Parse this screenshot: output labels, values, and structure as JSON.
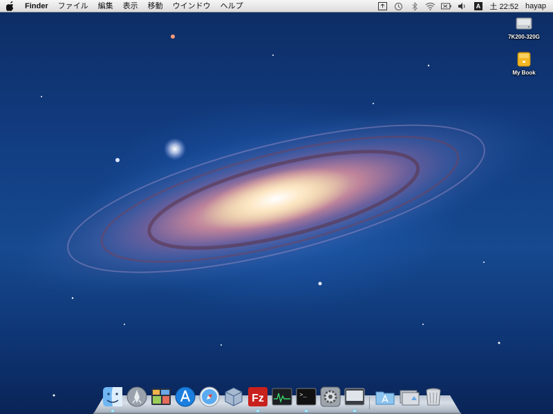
{
  "menubar": {
    "apple_icon": "apple-logo-icon",
    "app_name": "Finder",
    "items": [
      {
        "label": "ファイル"
      },
      {
        "label": "編集"
      },
      {
        "label": "表示"
      },
      {
        "label": "移動"
      },
      {
        "label": "ウインドウ"
      },
      {
        "label": "ヘルプ"
      }
    ],
    "status_icons": [
      "screen-sharing-icon",
      "time-machine-icon",
      "bluetooth-icon",
      "wifi-icon",
      "battery-icon",
      "volume-icon",
      "input-method-icon"
    ],
    "input_method_glyph": "A",
    "clock": "土 22:52",
    "user": "hayap"
  },
  "desktop_icons": [
    {
      "label": "7K200-320G",
      "icon": "hard-drive-icon"
    },
    {
      "label": "My Book",
      "icon": "external-drive-icon"
    }
  ],
  "dock": {
    "items": [
      {
        "name": "finder",
        "icon": "finder-icon"
      },
      {
        "name": "launchpad",
        "icon": "launchpad-icon"
      },
      {
        "name": "mission-control",
        "icon": "mission-control-icon"
      },
      {
        "name": "app-store",
        "icon": "app-store-icon"
      },
      {
        "name": "safari",
        "icon": "safari-icon"
      },
      {
        "name": "virtualbox",
        "icon": "virtualbox-icon"
      },
      {
        "name": "filezilla",
        "icon": "filezilla-icon",
        "glyph": "Fz"
      },
      {
        "name": "activity-monitor",
        "icon": "activity-monitor-icon"
      },
      {
        "name": "terminal",
        "icon": "terminal-icon",
        "glyph": ">_"
      },
      {
        "name": "system-preferences",
        "icon": "system-preferences-icon"
      },
      {
        "name": "display-app",
        "icon": "display-icon"
      }
    ],
    "right_items": [
      {
        "name": "applications-folder",
        "icon": "applications-folder-icon"
      },
      {
        "name": "downloads-stack",
        "icon": "downloads-stack-icon"
      },
      {
        "name": "trash",
        "icon": "trash-icon"
      }
    ]
  },
  "colors": {
    "wallpaper_base": "#123d82",
    "galaxy_core": "#f7e6c9",
    "galaxy_arm": "#c9899f",
    "menubar": "#e6e6e6",
    "filezilla_red": "#c8201c"
  }
}
